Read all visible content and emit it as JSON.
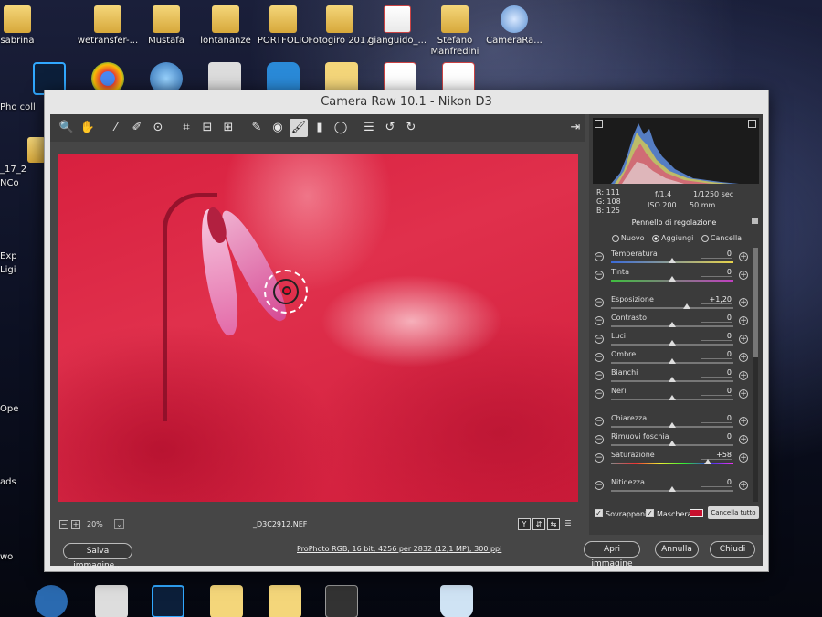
{
  "desktop": {
    "top_icons": [
      "sabrina",
      "wetransfer-...",
      "Mustafa",
      "lontananze",
      "PORTFOLIO",
      "Fotogiro 2017",
      "gianguido_...",
      "Stefano Manfredini",
      "CameraRa..."
    ],
    "left_labels": [
      "Pho coll",
      "NCo",
      "Exp",
      "Ligi",
      "Ope",
      "ads",
      "wo"
    ],
    "left_fragment": "_17_2"
  },
  "window": {
    "title": "Camera Raw 10.1  -  Nikon D3",
    "toolbar": {
      "tools": [
        {
          "name": "zoom-icon",
          "glyph": "🔍"
        },
        {
          "name": "hand-icon",
          "glyph": "✋"
        },
        {
          "name": "white-balance-icon",
          "glyph": "⁄"
        },
        {
          "name": "color-sampler-icon",
          "glyph": "✐"
        },
        {
          "name": "targeted-adjustment-icon",
          "glyph": "⊙"
        },
        {
          "name": "crop-icon",
          "glyph": "⌗"
        },
        {
          "name": "straighten-icon",
          "glyph": "⊟"
        },
        {
          "name": "transform-icon",
          "glyph": "⊞"
        },
        {
          "name": "spot-removal-icon",
          "glyph": "✎"
        },
        {
          "name": "red-eye-icon",
          "glyph": "◉"
        },
        {
          "name": "adjustment-brush-icon",
          "glyph": "🖌"
        },
        {
          "name": "graduated-filter-icon",
          "glyph": "▮"
        },
        {
          "name": "radial-filter-icon",
          "glyph": "◯"
        },
        {
          "name": "preferences-icon",
          "glyph": "☰"
        },
        {
          "name": "rotate-ccw-icon",
          "glyph": "↺"
        },
        {
          "name": "rotate-cw-icon",
          "glyph": "↻"
        }
      ],
      "active_tool": "adjustment-brush-icon",
      "exit_glyph": "⇥"
    },
    "status": {
      "zoom_minus": "−",
      "zoom_plus": "+",
      "zoom": "20%",
      "zoom_dropdown": "⌄",
      "filename": "_D3C2912.NEF",
      "view_buttons": [
        "Y",
        "⇵",
        "⇆",
        "☰"
      ]
    },
    "bottom": {
      "save_label": "Salva immagine...",
      "workflow": "ProPhoto RGB; 16 bit; 4256 per 2832 (12,1 MP); 300 ppi",
      "open_label": "Apri immagine",
      "cancel_label": "Annulla",
      "close_label": "Chiudi"
    }
  },
  "panel": {
    "readout": {
      "r_label": "R:",
      "r": "111",
      "g_label": "G:",
      "g": "108",
      "b_label": "B:",
      "b": "125",
      "aperture": "f/1,4",
      "shutter": "1/1250 sec",
      "iso": "ISO 200",
      "focal": "50 mm"
    },
    "title": "Pennello di regolazione",
    "modes": {
      "new": "Nuovo",
      "add": "Aggiungi",
      "erase": "Cancella",
      "selected": "Aggiungi"
    },
    "sliders": [
      {
        "label": "Temperatura",
        "value": "0",
        "level": 0.5,
        "track": "linear-gradient(90deg,#3a6ad8,#e8d44a)"
      },
      {
        "label": "Tinta",
        "value": "0",
        "level": 0.5,
        "track": "linear-gradient(90deg,#3fbf3f,#c03fc0)"
      },
      {
        "label": "Esposizione",
        "value": "+1,20",
        "level": 0.62,
        "track": "#777777"
      },
      {
        "label": "Contrasto",
        "value": "0",
        "level": 0.5,
        "track": "#777777"
      },
      {
        "label": "Luci",
        "value": "0",
        "level": 0.5,
        "track": "#777777"
      },
      {
        "label": "Ombre",
        "value": "0",
        "level": 0.5,
        "track": "#777777"
      },
      {
        "label": "Bianchi",
        "value": "0",
        "level": 0.5,
        "track": "#777777"
      },
      {
        "label": "Neri",
        "value": "0",
        "level": 0.5,
        "track": "#777777"
      },
      {
        "label": "Chiarezza",
        "value": "0",
        "level": 0.5,
        "track": "#777777"
      },
      {
        "label": "Rimuovi foschia",
        "value": "0",
        "level": 0.5,
        "track": "#777777"
      },
      {
        "label": "Saturazione",
        "value": "+58",
        "level": 0.79,
        "track": "linear-gradient(90deg,#888,#e33,#ee3,#3e3,#33e,#e3e)"
      },
      {
        "label": "Nitidezza",
        "value": "0",
        "level": 0.5,
        "track": "#777777"
      }
    ],
    "overlay_label": "Sovrapponi",
    "mask_label": "Maschera",
    "mask_color": "#c8102e",
    "clear_label": "Cancella tutto",
    "check_glyph": "✓"
  }
}
